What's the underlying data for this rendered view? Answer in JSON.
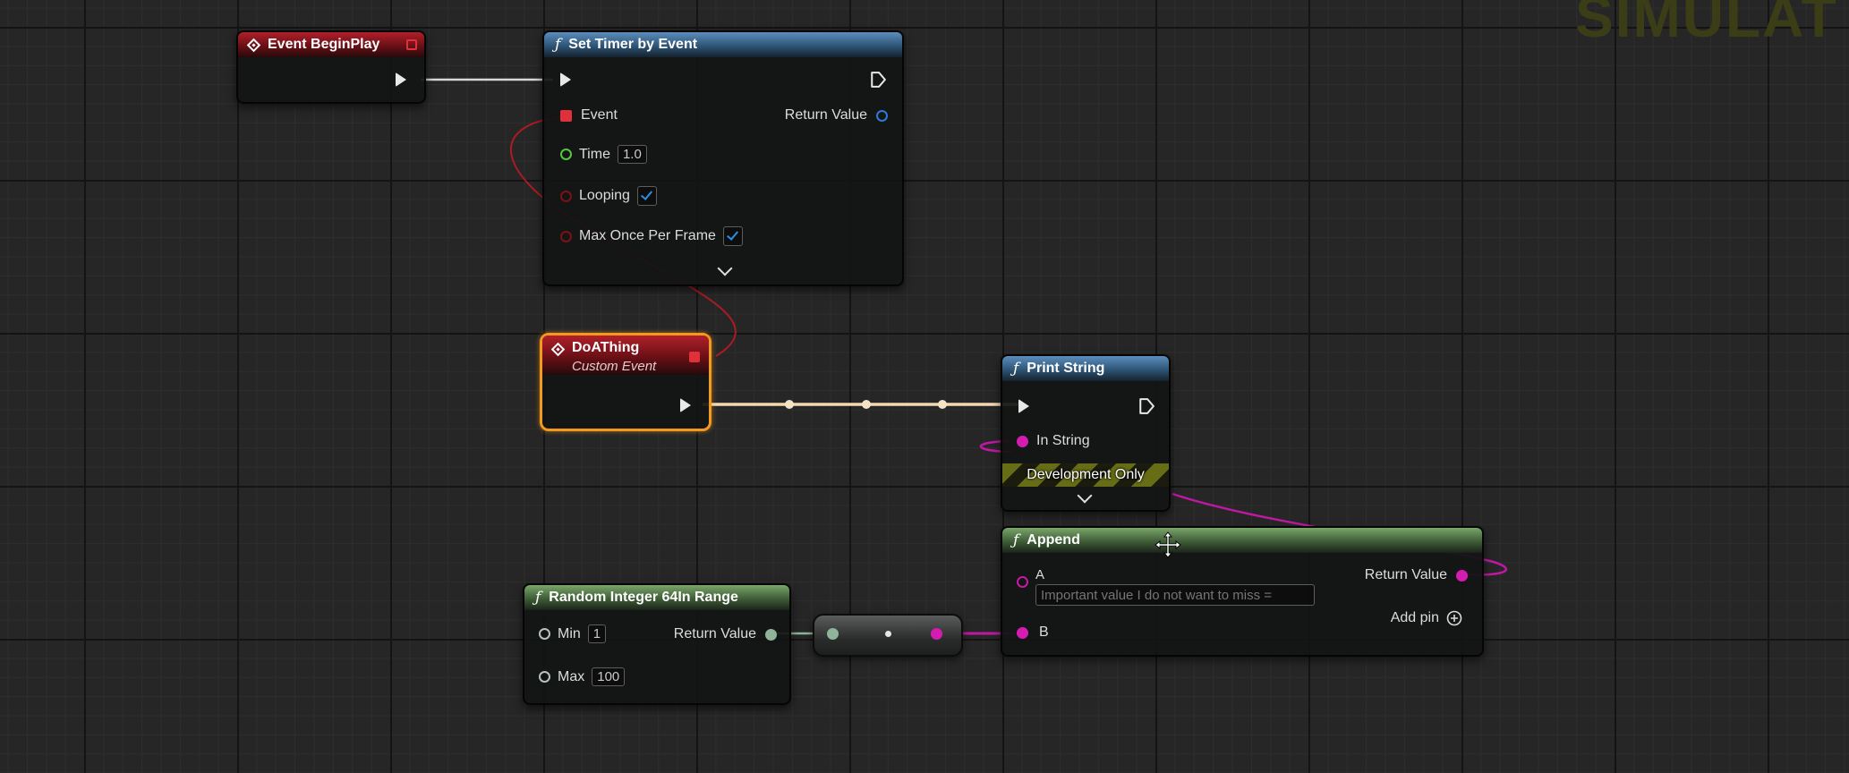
{
  "watermark": "SIMULAT",
  "nodes": {
    "begin_play": {
      "title": "Event BeginPlay"
    },
    "set_timer": {
      "title": "Set Timer by Event",
      "pins": {
        "event": "Event",
        "return_value": "Return Value",
        "time": "Time",
        "time_value": "1.0",
        "looping": "Looping",
        "looping_checked": true,
        "max_once": "Max Once Per Frame",
        "max_once_checked": true
      }
    },
    "do_a_thing": {
      "title": "DoAThing",
      "subtitle": "Custom Event"
    },
    "print_string": {
      "title": "Print String",
      "pins": {
        "in_string": "In String"
      },
      "dev_only": "Development Only"
    },
    "append": {
      "title": "Append",
      "pins": {
        "a": "A",
        "a_placeholder": "Important value I do not want to miss =",
        "b": "B",
        "return_value": "Return Value",
        "add_pin": "Add pin"
      }
    },
    "random_int": {
      "title": "Random Integer 64In Range",
      "pins": {
        "min": "Min",
        "min_value": "1",
        "max": "Max",
        "max_value": "100",
        "return_value": "Return Value"
      }
    }
  },
  "colors": {
    "exec": "#e8e8e8",
    "string_pin": "#d51cb2",
    "delegate_wire": "#c8202a",
    "int64_pin": "#8fb49a",
    "selection": "#f29a1e"
  }
}
